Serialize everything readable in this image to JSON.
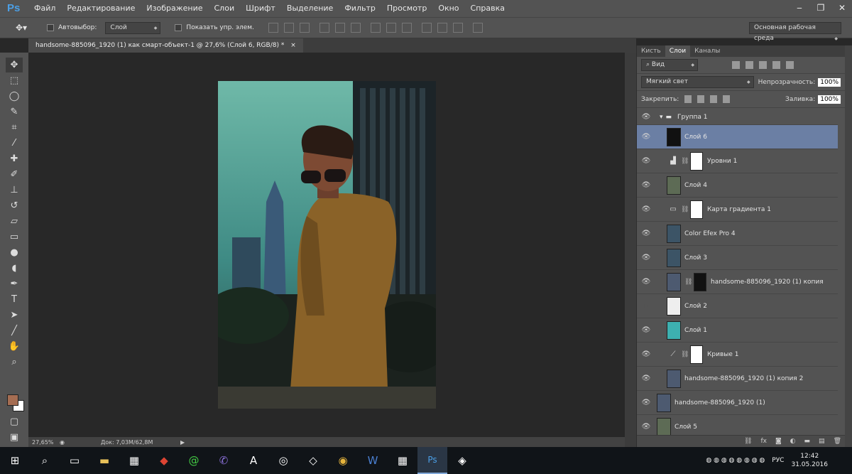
{
  "app": {
    "logo": "Ps"
  },
  "menu": [
    "Файл",
    "Редактирование",
    "Изображение",
    "Слои",
    "Шрифт",
    "Выделение",
    "Фильтр",
    "Просмотр",
    "Окно",
    "Справка"
  ],
  "window_buttons": [
    "‒",
    "❐",
    "✕"
  ],
  "options": {
    "autoselect_label": "Автовыбор:",
    "autoselect_value": "Слой",
    "show_controls_label": "Показать упр. элем.",
    "workspace": "Основная рабочая среда"
  },
  "document": {
    "tab_title": "handsome-885096_1920 (1) как смарт-объект-1 @ 27,6% (Слой 6, RGB/8) *",
    "close": "×",
    "zoom": "27,65%",
    "doc_size": "Док: 7,03M/62,8M"
  },
  "colors": {
    "foreground": "#a56d52",
    "background": "#ffffff",
    "selected_layer": "#6b7fa4"
  },
  "panel": {
    "tabs": [
      "Кисть",
      "Слои",
      "Каналы"
    ],
    "active_tab": "Слои",
    "filter_kind": "Вид",
    "blend_mode": "Мягкий свет",
    "opacity_label": "Непрозрачность:",
    "opacity_value": "100%",
    "lock_label": "Закрепить:",
    "fill_label": "Заливка:",
    "fill_value": "100%"
  },
  "layers": [
    {
      "name": "Группа 1",
      "type": "group",
      "visible": true
    },
    {
      "name": "Слой 6",
      "type": "pixel",
      "visible": true,
      "selected": true,
      "thumb": "dark"
    },
    {
      "name": "Уровни 1",
      "type": "adjustment",
      "icon": "levels-icon",
      "visible": true
    },
    {
      "name": "Слой 4",
      "type": "pixel",
      "visible": true,
      "thumb": "photo"
    },
    {
      "name": "Карта градиента 1",
      "type": "adjustment",
      "icon": "gradient-map-icon",
      "visible": true
    },
    {
      "name": "Color Efex Pro 4",
      "type": "pixel",
      "visible": true,
      "thumb": "photo"
    },
    {
      "name": "Слой 3",
      "type": "pixel",
      "visible": true,
      "thumb": "photo"
    },
    {
      "name": "handsome-885096_1920 (1) копия",
      "type": "masked",
      "visible": true,
      "thumb": "photo"
    },
    {
      "name": "Слой 2",
      "type": "pixel",
      "visible": false,
      "thumb": "transparent"
    },
    {
      "name": "Слой 1",
      "type": "pixel",
      "visible": true,
      "thumb": "teal"
    },
    {
      "name": "Кривые 1",
      "type": "adjustment",
      "icon": "curves-icon",
      "visible": true
    },
    {
      "name": "handsome-885096_1920 (1) копия 2",
      "type": "pixel",
      "visible": true,
      "thumb": "photo"
    },
    {
      "name": "handsome-885096_1920 (1)",
      "type": "smart",
      "visible": true,
      "thumb": "photo"
    },
    {
      "name": "Слой 5",
      "type": "pixel",
      "visible": true,
      "thumb": "photo"
    }
  ],
  "taskbar": {
    "lang": "РУС",
    "time": "12:42",
    "date": "31.05.2016"
  }
}
